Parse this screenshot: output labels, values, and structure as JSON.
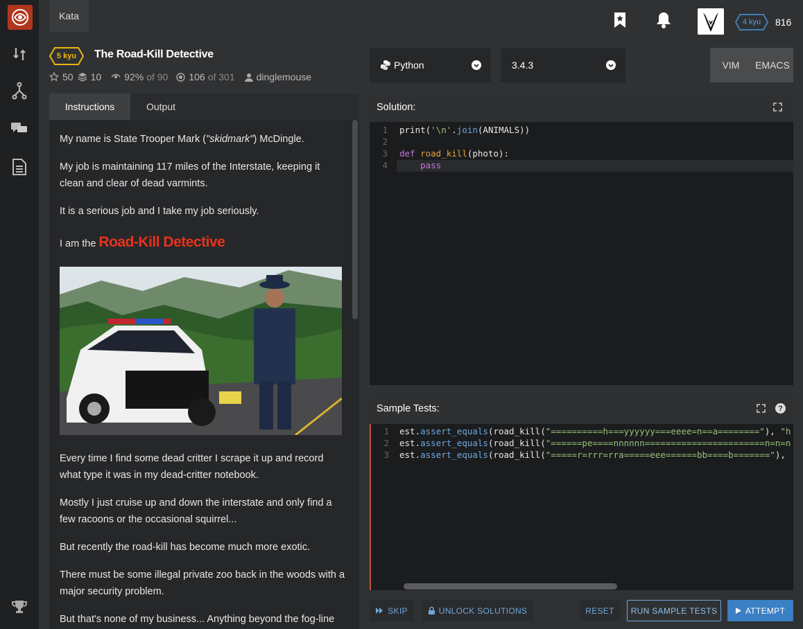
{
  "top": {
    "kata_tab": "Kata",
    "rank": "4 kyu",
    "honor": "816"
  },
  "kata": {
    "kyu": "5 kyu",
    "title": "The Road-Kill Detective",
    "stars": "50",
    "collections": "10",
    "satisfaction": "92%",
    "satisfaction_of": "of 90",
    "completed": "106",
    "completed_of": "of 301",
    "author": "dinglemouse"
  },
  "tabs": [
    {
      "label": "Instructions"
    },
    {
      "label": "Output"
    }
  ],
  "instructions": {
    "p1_a": "My name is State Trooper Mark (",
    "p1_b": "\"skidmark\"",
    "p1_c": ") McDingle.",
    "p2": "My job is maintaining 117 miles of the Interstate, keeping it clean and clear of dead varmints.",
    "p3": "It is a serious job and I take my job seriously.",
    "p4_a": "I am the ",
    "p4_b": "Road-Kill Detective",
    "p5": "Every time I find some dead critter I scrape it up and record what type it was in my dead-critter notebook.",
    "p6": "Mostly I just cruise up and down the interstate and only find a few racoons or the occasional squirrel...",
    "p7": "But recently the road-kill has become much more exotic.",
    "p8": "There must be some illegal private zoo back in the woods with a major security problem.",
    "p9": "But that's none of my business... Anything beyond the fog-line"
  },
  "language": {
    "selected": "Python",
    "version": "3.4.3"
  },
  "keybindings": [
    "VIM",
    "EMACS"
  ],
  "solution": {
    "header": "Solution:",
    "lines": [
      "1",
      "2",
      "3",
      "4"
    ]
  },
  "tests": {
    "header": "Sample Tests:",
    "lines": [
      "1",
      "2",
      "3"
    ]
  },
  "buttons": {
    "skip": "SKIP",
    "unlock": "UNLOCK SOLUTIONS",
    "reset": "RESET",
    "run": "RUN SAMPLE TESTS",
    "attempt": "ATTEMPT"
  },
  "colors": {
    "accent": "#6fa8dc",
    "kyu_yellow": "#ecb613",
    "rank_blue": "#3c7ebb",
    "road_kill_red": "#e8331c",
    "logo_red": "#b1361e"
  }
}
